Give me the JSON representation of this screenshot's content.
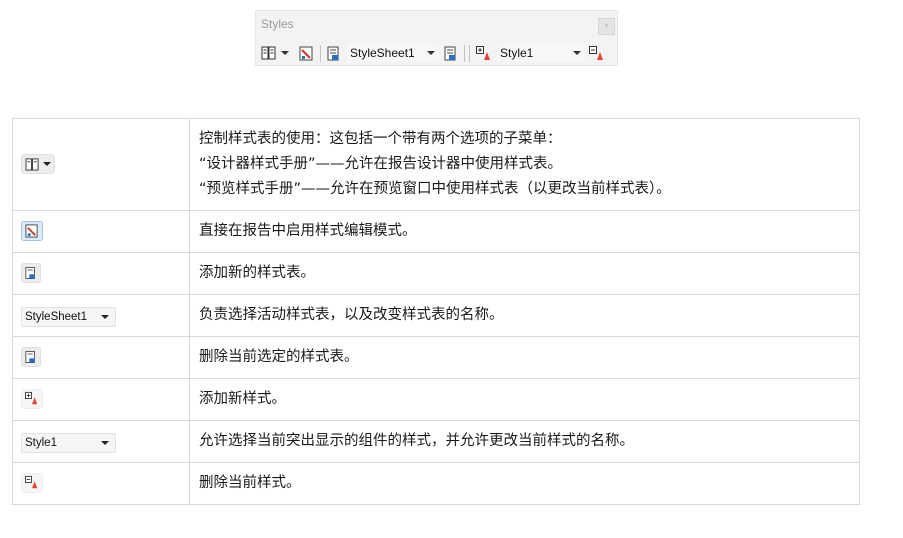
{
  "panel": {
    "title": "Styles",
    "stylesheet_combo": "StyleSheet1",
    "style_combo": "Style1"
  },
  "table": {
    "rows": [
      {
        "id": "use-stylesheet-menu",
        "lines": [
          "控制样式表的使用：这包括一个带有两个选项的子菜单：",
          "“设计器样式手册”——允许在报告设计器中使用样式表。",
          "“预览样式手册”——允许在预览窗口中使用样式表（以更改当前样式表）。"
        ]
      },
      {
        "id": "edit-mode",
        "text": "直接在报告中启用样式编辑模式。"
      },
      {
        "id": "add-stylesheet",
        "text": "添加新的样式表。"
      },
      {
        "id": "select-stylesheet",
        "combo": "StyleSheet1",
        "text": "负责选择活动样式表，以及改变样式表的名称。"
      },
      {
        "id": "delete-stylesheet",
        "text": "删除当前选定的样式表。"
      },
      {
        "id": "add-style",
        "text": "添加新样式。"
      },
      {
        "id": "select-style",
        "combo": "Style1",
        "text": "允许选择当前突出显示的组件的样式，并允许更改当前样式的名称。"
      },
      {
        "id": "delete-style",
        "text": "删除当前样式。"
      }
    ]
  },
  "icons": {
    "use-stylesheet": "stylesheet-book-icon",
    "edit-mode": "edit-style-icon",
    "add-stylesheet": "add-stylesheet-icon",
    "delete-stylesheet": "delete-stylesheet-icon",
    "add-style": "add-style-icon",
    "delete-style": "delete-style-icon"
  }
}
